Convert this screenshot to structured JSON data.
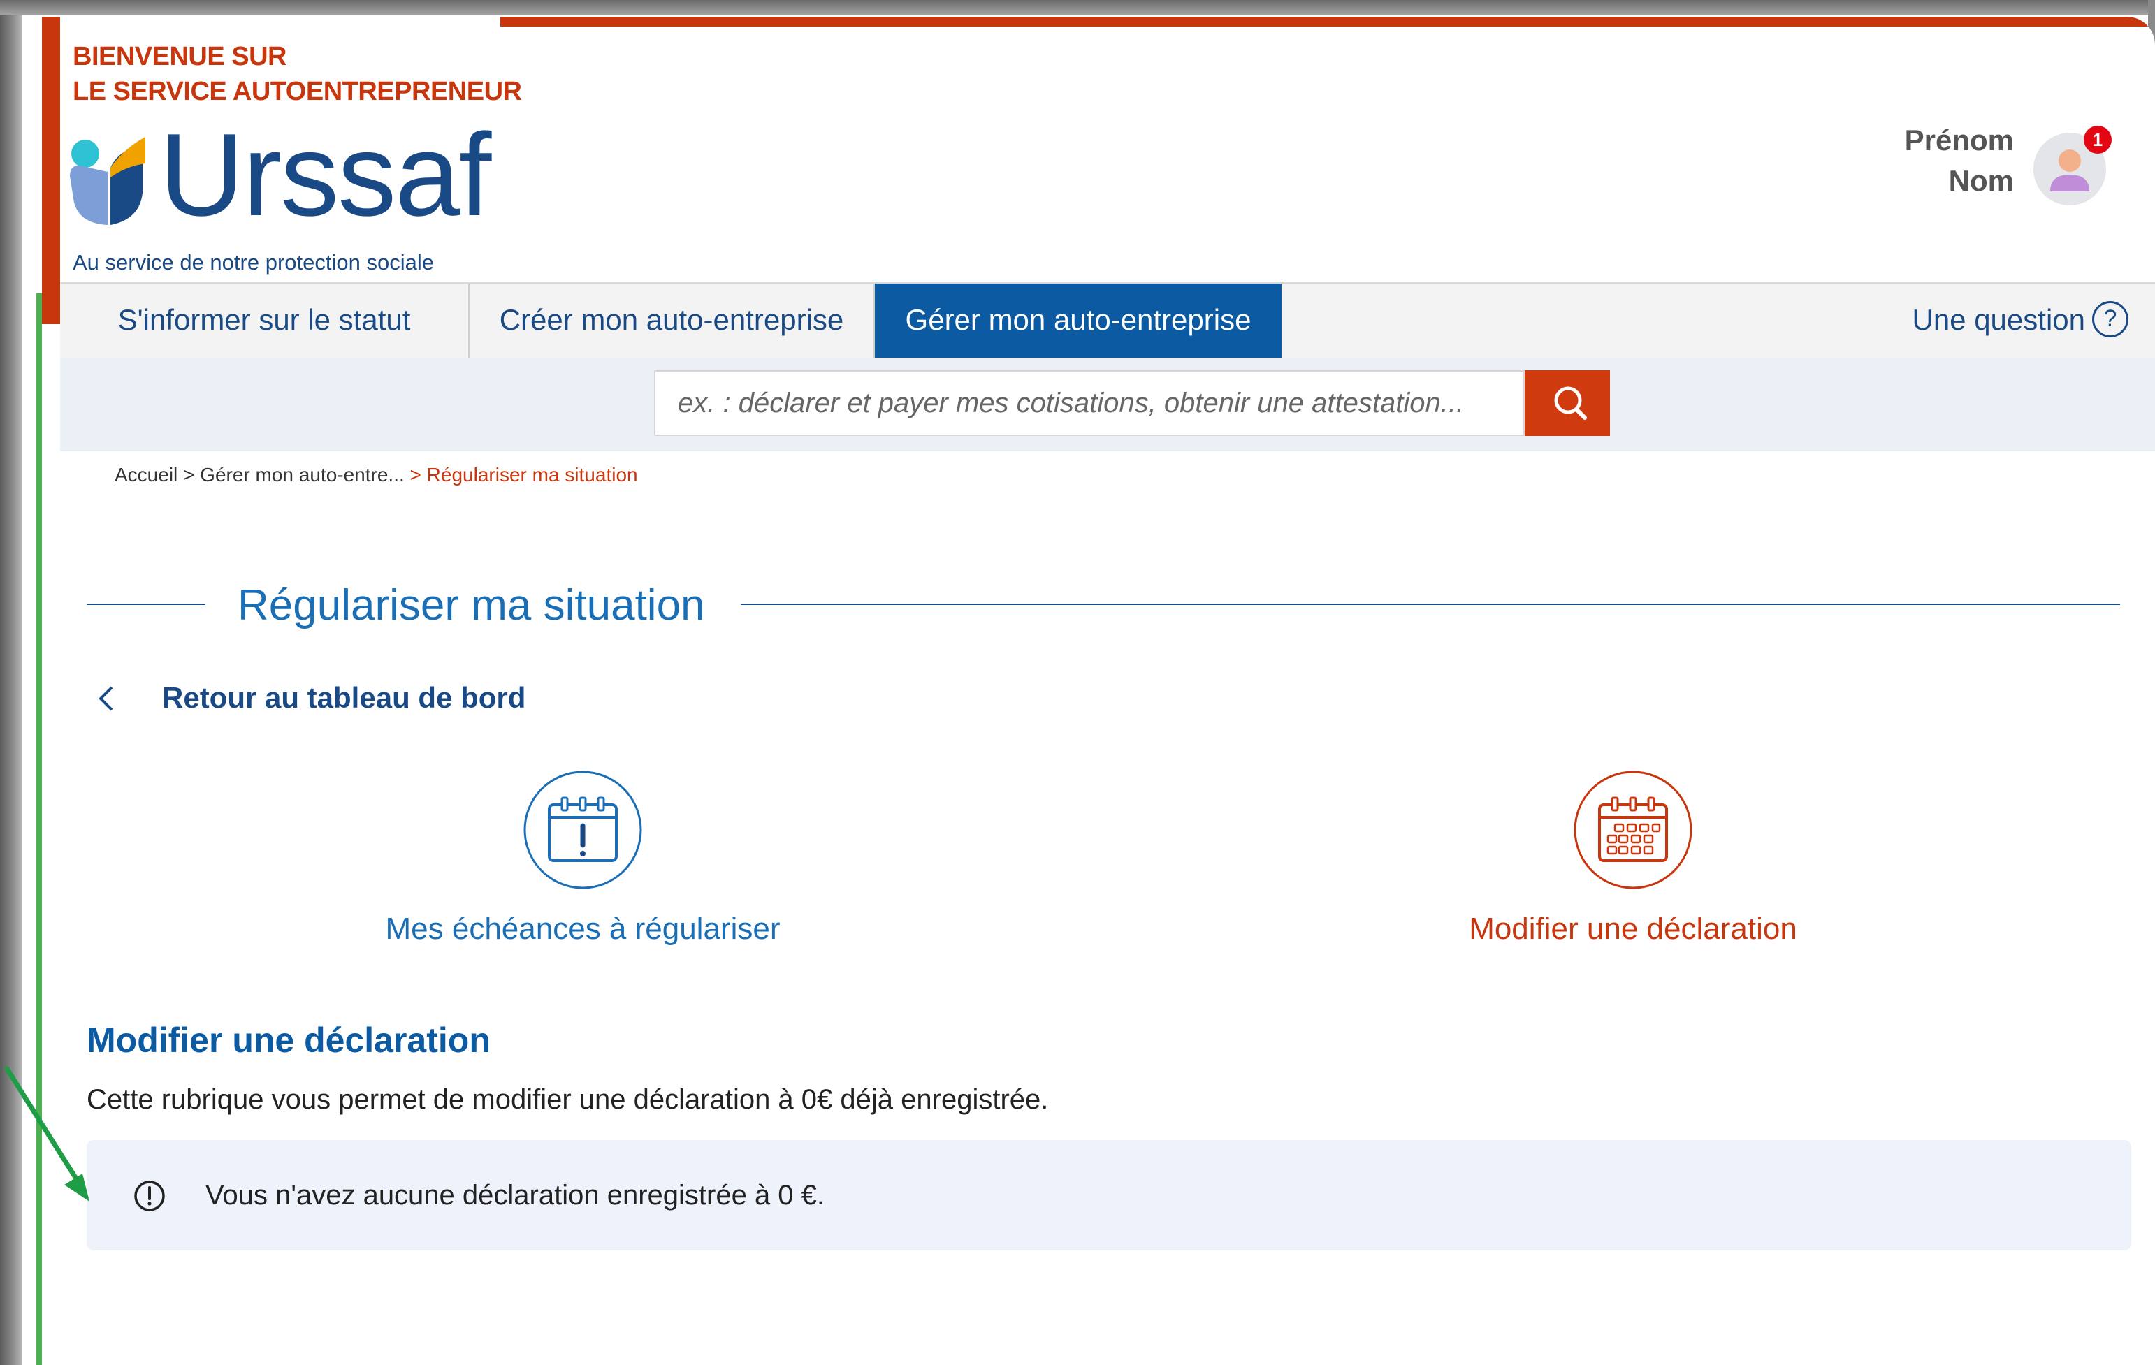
{
  "header": {
    "welcome_line1": "BIENVENUE SUR",
    "welcome_line2": "LE SERVICE AUTOENTREPRENEUR",
    "logo_word": "Urssaf",
    "logo_tagline": "Au service de notre protection sociale",
    "user_firstname": "Prénom",
    "user_lastname": "Nom",
    "notification_count": "1"
  },
  "nav": {
    "tabs": [
      {
        "label": "S'informer sur le statut",
        "active": false
      },
      {
        "label": "Créer mon auto-entreprise",
        "active": false
      },
      {
        "label": "Gérer mon auto-entreprise",
        "active": true
      }
    ],
    "question_label": "Une question",
    "question_icon": "?"
  },
  "search": {
    "placeholder": "ex. : déclarer et payer mes cotisations, obtenir une attestation..."
  },
  "breadcrumb": {
    "home": "Accueil",
    "middle": "> Gérer mon auto-entre...",
    "current": "> Régulariser ma situation"
  },
  "page": {
    "title": "Régulariser ma situation",
    "back_label": "Retour au tableau de bord",
    "choices": [
      {
        "label": "Mes échéances à régulariser",
        "icon": "calendar-alert-icon",
        "color": "#1a6eb5"
      },
      {
        "label": "Modifier une déclaration",
        "icon": "calendar-grid-icon",
        "color": "#c8360d"
      }
    ],
    "section_title": "Modifier une déclaration",
    "section_desc": "Cette rubrique vous permet de modifier une déclaration à 0€ déjà enregistrée.",
    "info_message": "Vous n'avez aucune déclaration enregistrée à 0 €."
  },
  "colors": {
    "brand_blue": "#1a4a86",
    "accent_blue": "#0b5aa2",
    "brand_red": "#c8360d",
    "annotation_green": "#1e9c46"
  }
}
